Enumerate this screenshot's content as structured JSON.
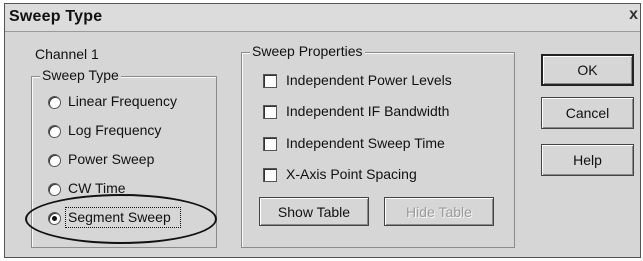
{
  "window": {
    "title": "Sweep Type",
    "close_glyph": "x"
  },
  "channel_label": "Channel 1",
  "sweep_type": {
    "legend": "Sweep Type",
    "options": [
      {
        "label": "Linear Frequency",
        "checked": false
      },
      {
        "label": "Log Frequency",
        "checked": false
      },
      {
        "label": "Power Sweep",
        "checked": false
      },
      {
        "label": "CW Time",
        "checked": false
      },
      {
        "label": "Segment Sweep",
        "checked": true
      }
    ]
  },
  "sweep_properties": {
    "legend": "Sweep Properties",
    "checkboxes": [
      {
        "label": "Independent Power Levels",
        "checked": false
      },
      {
        "label": "Independent IF Bandwidth",
        "checked": false
      },
      {
        "label": "Independent Sweep Time",
        "checked": false
      },
      {
        "label": "X-Axis Point Spacing",
        "checked": false
      }
    ],
    "show_table_label": "Show Table",
    "hide_table_label": "Hide Table"
  },
  "buttons": {
    "ok": "OK",
    "cancel": "Cancel",
    "help": "Help"
  }
}
